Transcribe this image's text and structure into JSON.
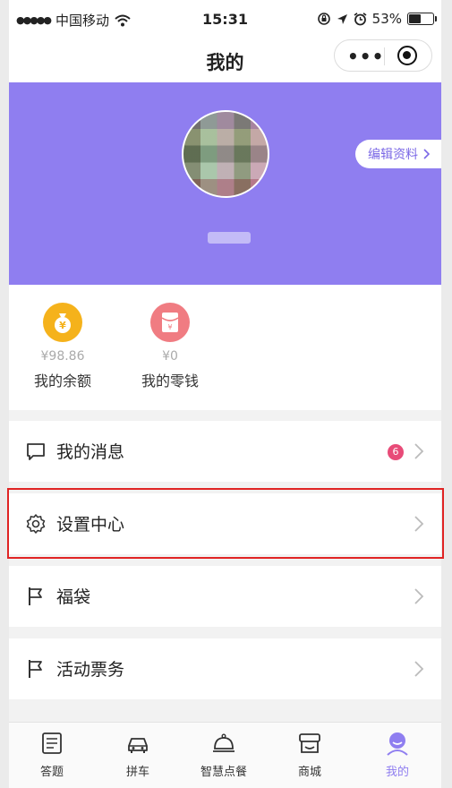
{
  "status_bar": {
    "carrier": "中国移动",
    "time": "15:31",
    "battery_percent": "53%",
    "battery_level": 0.53
  },
  "nav": {
    "title": "我的"
  },
  "profile": {
    "edit_label": "编辑资料"
  },
  "wallet": [
    {
      "amount": "¥98.86",
      "label": "我的余额",
      "icon": "money-bag-icon",
      "color": "#f5b21b"
    },
    {
      "amount": "¥0",
      "label": "我的零钱",
      "icon": "red-packet-icon",
      "color": "#f07c82"
    }
  ],
  "menu": [
    {
      "label": "我的消息",
      "icon": "message-icon",
      "badge": "6"
    },
    {
      "label": "设置中心",
      "icon": "gear-icon"
    },
    {
      "label": "福袋",
      "icon": "flag-icon"
    },
    {
      "label": "活动票务",
      "icon": "flag-icon"
    }
  ],
  "tabs": [
    {
      "label": "答题",
      "icon": "quiz-icon"
    },
    {
      "label": "拼车",
      "icon": "car-icon"
    },
    {
      "label": "智慧点餐",
      "icon": "dish-cover-icon"
    },
    {
      "label": "商城",
      "icon": "shop-icon"
    },
    {
      "label": "我的",
      "icon": "profile-icon",
      "active": true
    }
  ],
  "colors": {
    "accent": "#8f7ef0",
    "badge": "#e84b78",
    "highlight": "#e02424"
  }
}
